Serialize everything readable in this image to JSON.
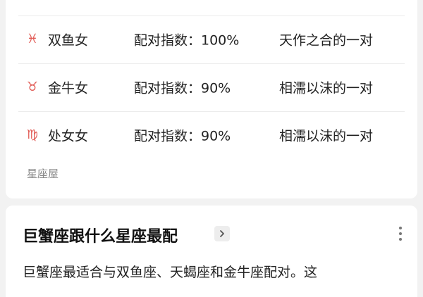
{
  "matches": [
    {
      "icon": "pisces-icon",
      "glyph": "♓",
      "name": "双鱼女",
      "score": "配对指数：100%",
      "desc": "天作之合的一对"
    },
    {
      "icon": "taurus-icon",
      "glyph": "♉",
      "name": "金牛女",
      "score": "配对指数：90%",
      "desc": "相濡以沫的一对"
    },
    {
      "icon": "virgo-icon",
      "glyph": "♍",
      "name": "处女女",
      "score": "配对指数：90%",
      "desc": "相濡以沫的一对"
    }
  ],
  "source": "星座屋",
  "result": {
    "title": "巨蟹座跟什么星座最配",
    "excerpt": "巨蟹座最适合与双鱼座、天蝎座和金牛座配对。这"
  },
  "colors": {
    "sign_accent": "#e15b55",
    "card_background": "#ffffff",
    "page_background": "#f2f2f2"
  }
}
